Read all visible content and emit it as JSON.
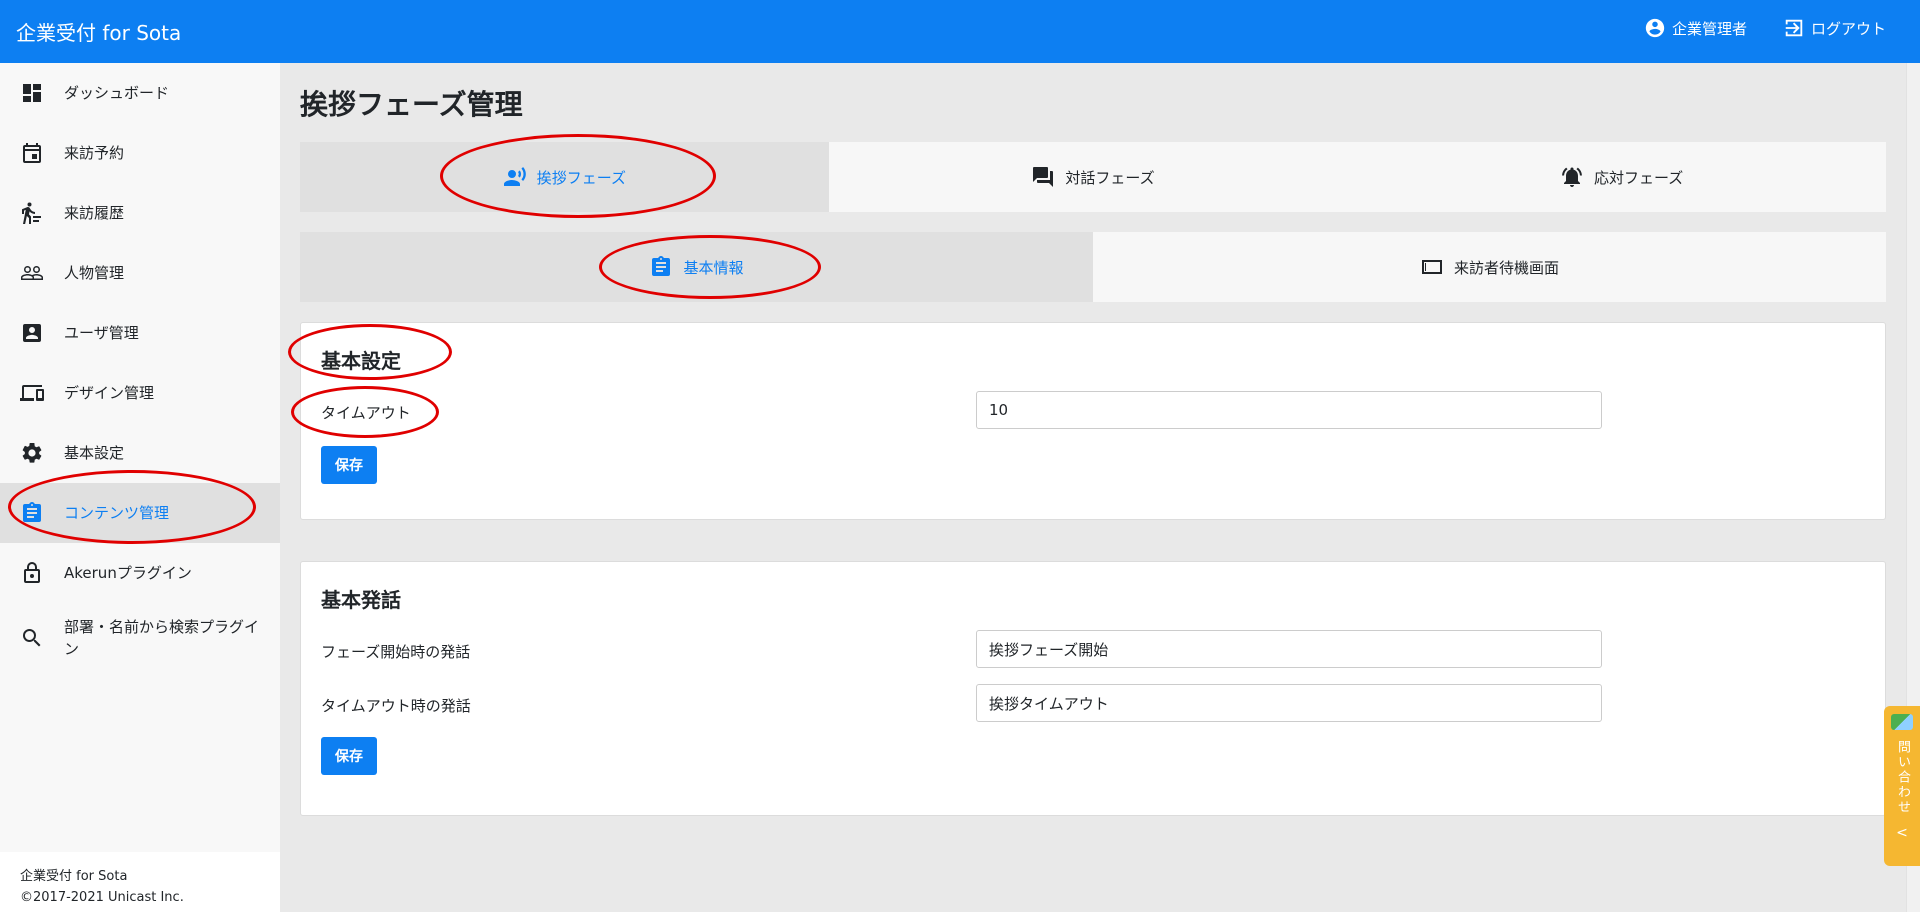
{
  "header": {
    "brand": "企業受付 for Sota",
    "user_label": "企業管理者",
    "logout_label": "ログアウト"
  },
  "sidebar": {
    "items": [
      {
        "label": "ダッシュボード",
        "icon": "dashboard-icon"
      },
      {
        "label": "来訪予約",
        "icon": "calendar-icon"
      },
      {
        "label": "来訪履歴",
        "icon": "walking-person-icon"
      },
      {
        "label": "人物管理",
        "icon": "people-icon"
      },
      {
        "label": "ユーザ管理",
        "icon": "user-card-icon"
      },
      {
        "label": "デザイン管理",
        "icon": "devices-icon"
      },
      {
        "label": "基本設定",
        "icon": "gear-icon"
      },
      {
        "label": "コンテンツ管理",
        "icon": "clipboard-icon",
        "active": true
      },
      {
        "label": "Akerunプラグイン",
        "icon": "lock-icon"
      },
      {
        "label": "部署・名前から検索プラグイン",
        "icon": "search-icon"
      }
    ],
    "footer_line1": "企業受付 for Sota",
    "footer_line2": "©2017-2021 Unicast Inc."
  },
  "main": {
    "page_title": "挨拶フェーズ管理",
    "phase_tabs": [
      {
        "label": "挨拶フェーズ",
        "icon": "speaking-person-icon",
        "active": true
      },
      {
        "label": "対話フェーズ",
        "icon": "chat-icon"
      },
      {
        "label": "応対フェーズ",
        "icon": "bell-icon"
      }
    ],
    "sub_tabs": [
      {
        "label": "基本情報",
        "icon": "clipboard-icon",
        "active": true
      },
      {
        "label": "来訪者待機画面",
        "icon": "screen-icon"
      }
    ],
    "basic_settings": {
      "title": "基本設定",
      "timeout_label": "タイムアウト",
      "timeout_value": "10",
      "save_label": "保存"
    },
    "basic_speech": {
      "title": "基本発話",
      "start_label": "フェーズ開始時の発話",
      "start_value": "挨拶フェーズ開始",
      "timeout_label": "タイムアウト時の発話",
      "timeout_value": "挨拶タイムアウト",
      "save_label": "保存"
    }
  },
  "inquiry": {
    "label": "問い合わせ",
    "chevron": "<"
  },
  "colors": {
    "primary": "#0d7ff2",
    "annotation": "#e00000",
    "inquiry": "#f5b731"
  }
}
